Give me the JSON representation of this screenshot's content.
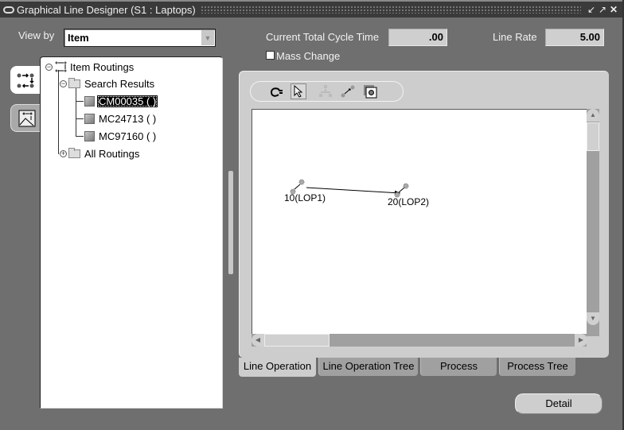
{
  "window": {
    "title": "Graphical Line Designer (S1 : Laptops)",
    "controls": [
      "minimize-icon",
      "maximize-icon",
      "close-icon"
    ]
  },
  "header": {
    "view_by_label": "View by",
    "view_by_value": "Item",
    "cycle_time_label": "Current Total Cycle Time",
    "cycle_time_value": ".00",
    "line_rate_label": "Line Rate",
    "line_rate_value": "5.00",
    "mass_change_label": "Mass Change",
    "mass_change_checked": false
  },
  "side_tabs": [
    {
      "icon": "routing-flow-icon",
      "active": true
    },
    {
      "icon": "diagram-icon",
      "active": false
    }
  ],
  "tree": {
    "root": "Item Routings",
    "search_results": "Search Results",
    "items": [
      "CM00035 ( )",
      "MC24713 ( )",
      "MC97160 ( )"
    ],
    "selected_index": 0,
    "all_routings": "All Routings"
  },
  "toolbar": {
    "buttons": [
      "connect-plug-icon",
      "select-pointer-icon",
      "layout-tree-icon",
      "link-ops-icon",
      "properties-icon"
    ]
  },
  "canvas": {
    "operations": [
      {
        "label": "10(LOP1)"
      },
      {
        "label": "20(LOP2)"
      }
    ]
  },
  "bottom_tabs": [
    {
      "label": "Line Operation",
      "active": true
    },
    {
      "label": "Line Operation Tree",
      "active": false
    },
    {
      "label": "Process",
      "active": false
    },
    {
      "label": "Process Tree",
      "active": false
    }
  ],
  "actions": {
    "detail_label": "Detail"
  }
}
